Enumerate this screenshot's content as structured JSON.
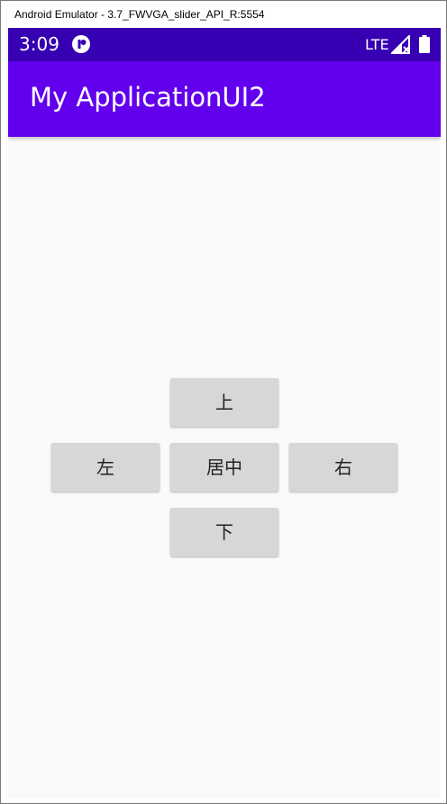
{
  "window": {
    "title": "Android Emulator - 3.7_FWVGA_slider_API_R:5554"
  },
  "status_bar": {
    "time": "3:09",
    "network": "LTE",
    "icons": [
      "app-notification-icon",
      "signal-icon",
      "battery-icon"
    ],
    "color": "#3700b3"
  },
  "app_bar": {
    "title": "My ApplicationUI2",
    "color": "#6200ee"
  },
  "buttons": {
    "up": "上",
    "left": "左",
    "center": "居中",
    "right": "右",
    "down": "下"
  }
}
